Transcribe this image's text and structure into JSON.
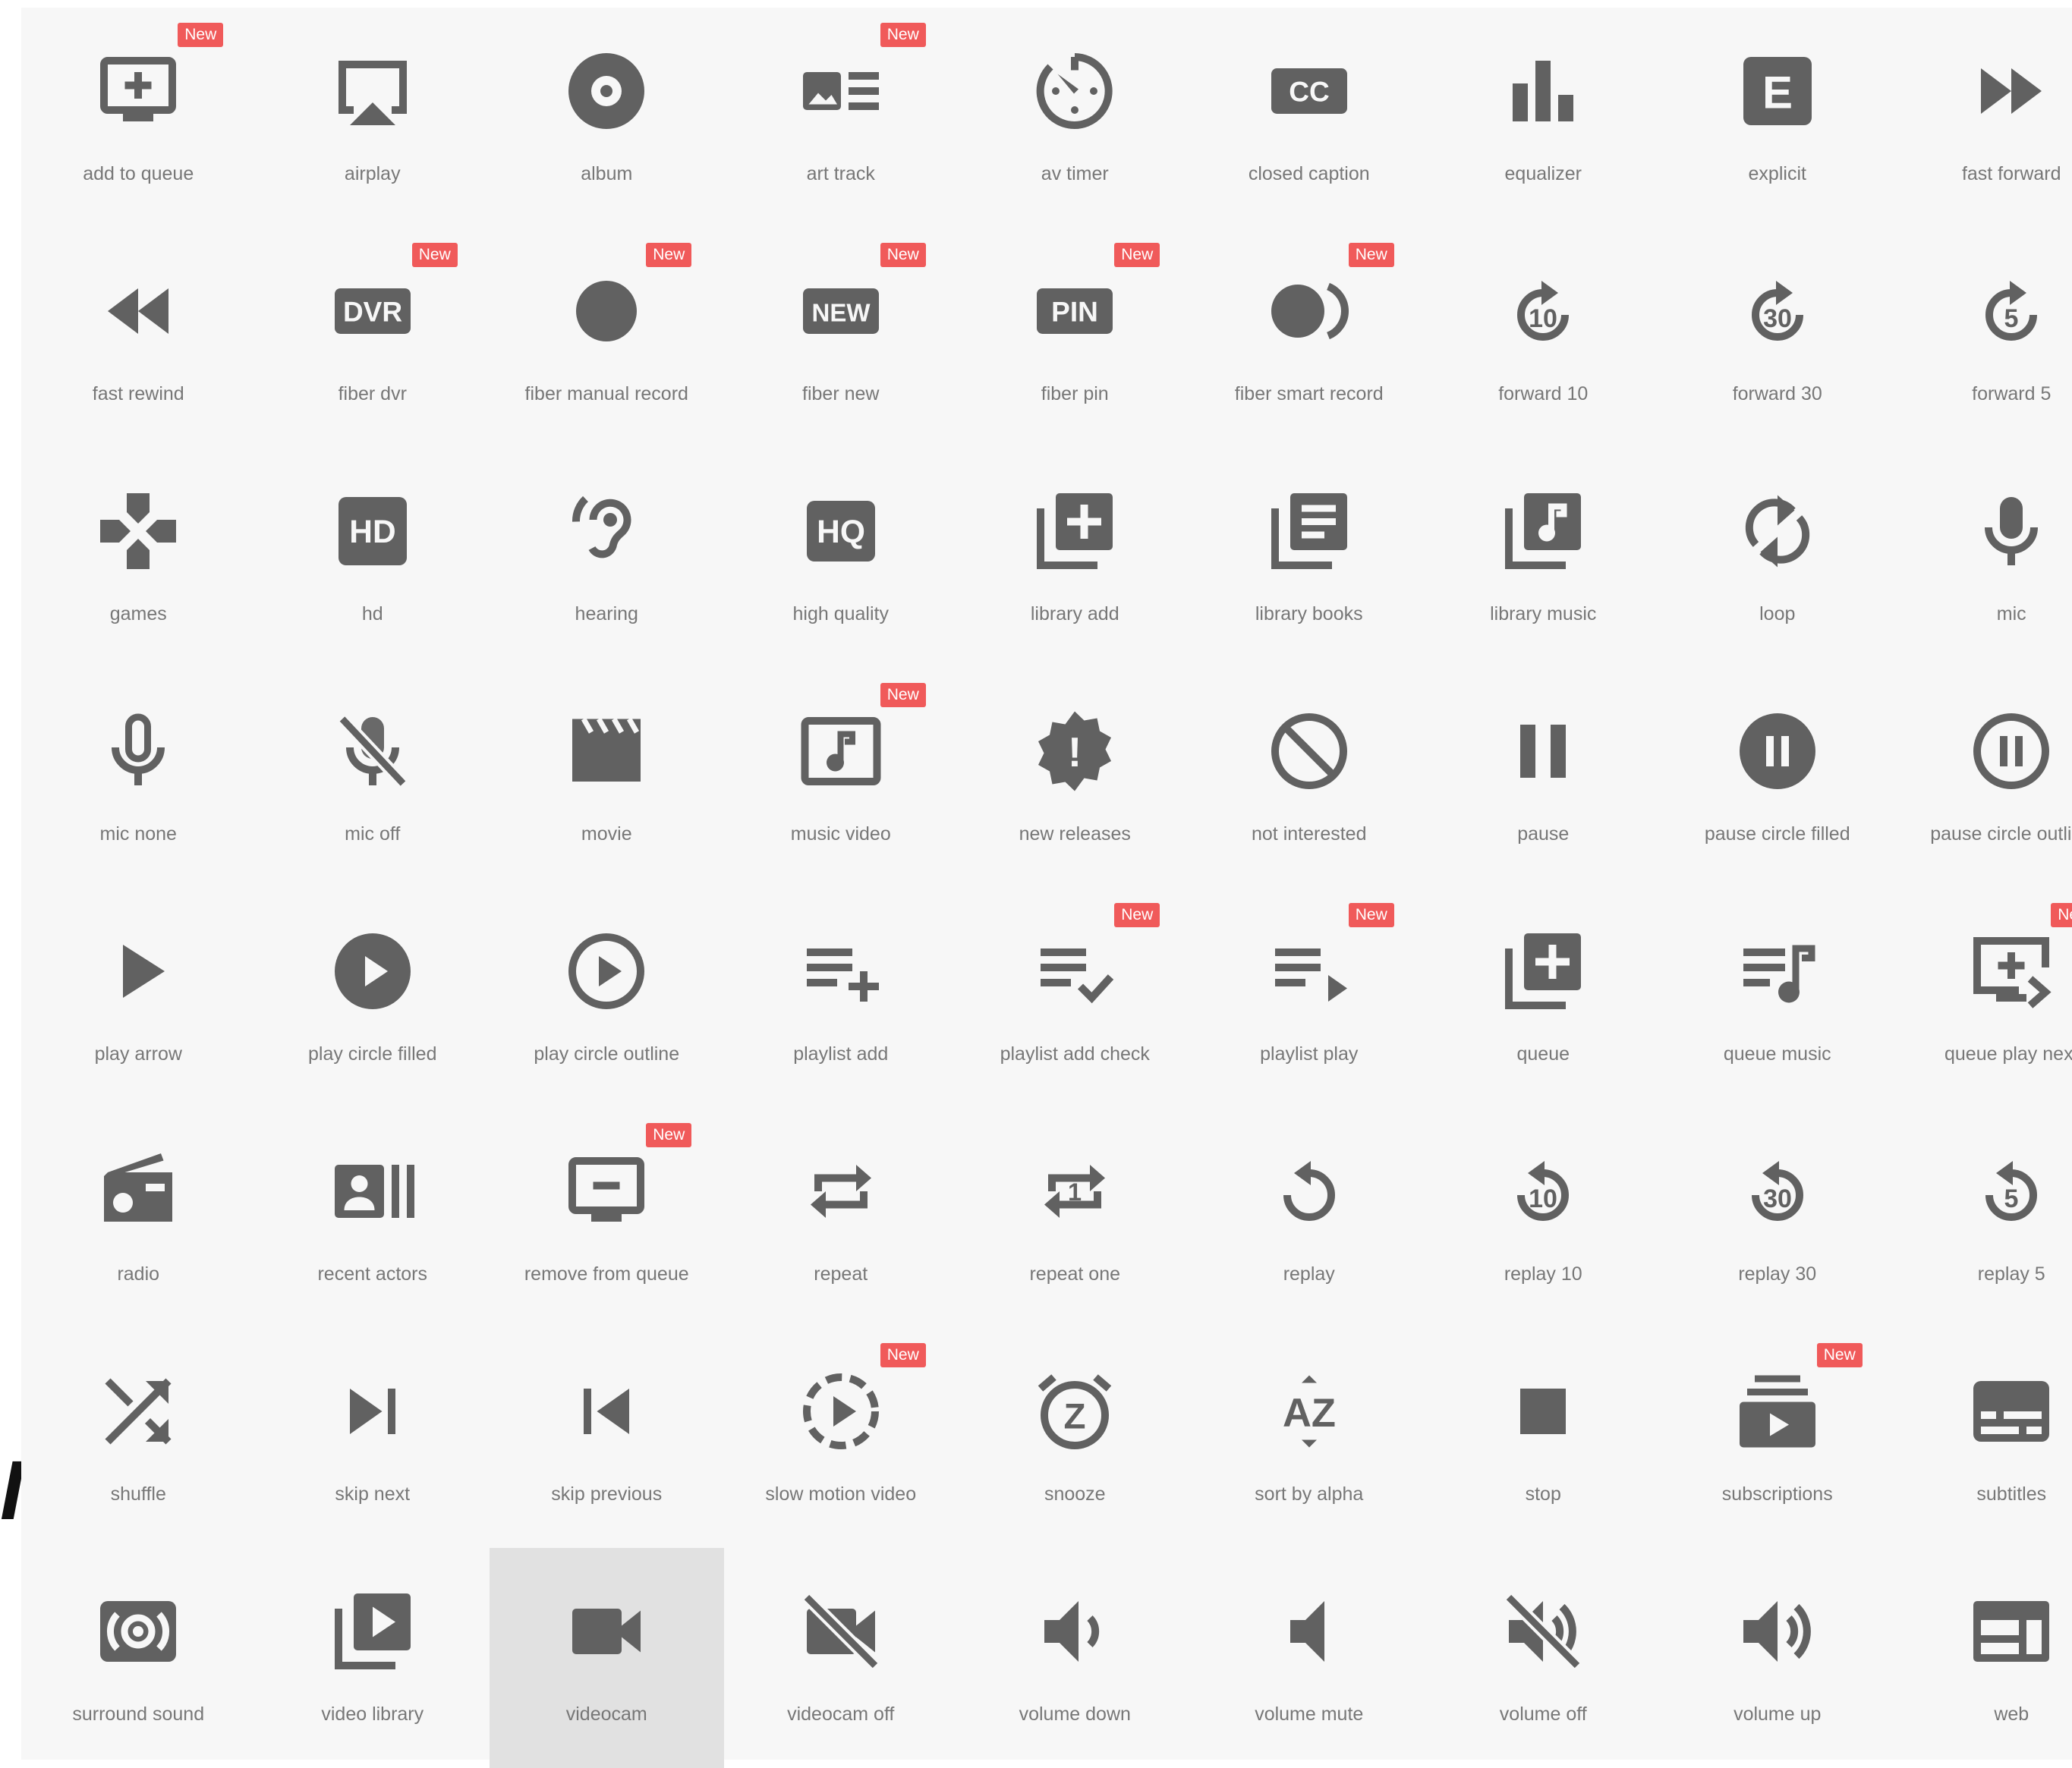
{
  "badge_label": "New",
  "edge_glyph": "I",
  "colors": {
    "icon": "#616161",
    "label": "#777777",
    "badge": "#f05a5a",
    "panel": "#f7f7f7",
    "selected": "#e1e1e1"
  },
  "icons": [
    {
      "name": "add to queue",
      "icon": "add-to-queue-icon",
      "isNew": true
    },
    {
      "name": "airplay",
      "icon": "airplay-icon"
    },
    {
      "name": "album",
      "icon": "album-icon"
    },
    {
      "name": "art track",
      "icon": "art-track-icon",
      "isNew": true
    },
    {
      "name": "av timer",
      "icon": "av-timer-icon"
    },
    {
      "name": "closed caption",
      "icon": "closed-caption-icon",
      "text": "CC"
    },
    {
      "name": "equalizer",
      "icon": "equalizer-icon"
    },
    {
      "name": "explicit",
      "icon": "explicit-icon",
      "text": "E"
    },
    {
      "name": "fast forward",
      "icon": "fast-forward-icon"
    },
    {
      "name": "fast rewind",
      "icon": "fast-rewind-icon"
    },
    {
      "name": "fiber dvr",
      "icon": "fiber-dvr-icon",
      "isNew": true,
      "text": "DVR"
    },
    {
      "name": "fiber manual record",
      "icon": "fiber-manual-record-icon",
      "isNew": true
    },
    {
      "name": "fiber new",
      "icon": "fiber-new-icon",
      "isNew": true,
      "text": "NEW"
    },
    {
      "name": "fiber pin",
      "icon": "fiber-pin-icon",
      "isNew": true,
      "text": "PIN"
    },
    {
      "name": "fiber smart record",
      "icon": "fiber-smart-record-icon",
      "isNew": true
    },
    {
      "name": "forward 10",
      "icon": "forward-10-icon",
      "text": "10"
    },
    {
      "name": "forward 30",
      "icon": "forward-30-icon",
      "text": "30"
    },
    {
      "name": "forward 5",
      "icon": "forward-5-icon",
      "text": "5"
    },
    {
      "name": "games",
      "icon": "games-icon"
    },
    {
      "name": "hd",
      "icon": "hd-icon",
      "text": "HD"
    },
    {
      "name": "hearing",
      "icon": "hearing-icon"
    },
    {
      "name": "high quality",
      "icon": "high-quality-icon",
      "text": "HQ"
    },
    {
      "name": "library add",
      "icon": "library-add-icon"
    },
    {
      "name": "library books",
      "icon": "library-books-icon"
    },
    {
      "name": "library music",
      "icon": "library-music-icon"
    },
    {
      "name": "loop",
      "icon": "loop-icon"
    },
    {
      "name": "mic",
      "icon": "mic-icon"
    },
    {
      "name": "mic none",
      "icon": "mic-none-icon"
    },
    {
      "name": "mic off",
      "icon": "mic-off-icon"
    },
    {
      "name": "movie",
      "icon": "movie-icon"
    },
    {
      "name": "music video",
      "icon": "music-video-icon",
      "isNew": true
    },
    {
      "name": "new releases",
      "icon": "new-releases-icon",
      "text": "!"
    },
    {
      "name": "not interested",
      "icon": "not-interested-icon"
    },
    {
      "name": "pause",
      "icon": "pause-icon"
    },
    {
      "name": "pause circle filled",
      "icon": "pause-circle-filled-icon"
    },
    {
      "name": "pause circle outline",
      "icon": "pause-circle-outline-icon"
    },
    {
      "name": "play arrow",
      "icon": "play-arrow-icon"
    },
    {
      "name": "play circle filled",
      "icon": "play-circle-filled-icon"
    },
    {
      "name": "play circle outline",
      "icon": "play-circle-outline-icon"
    },
    {
      "name": "playlist add",
      "icon": "playlist-add-icon"
    },
    {
      "name": "playlist add check",
      "icon": "playlist-add-check-icon",
      "isNew": true
    },
    {
      "name": "playlist play",
      "icon": "playlist-play-icon",
      "isNew": true
    },
    {
      "name": "queue",
      "icon": "queue-icon"
    },
    {
      "name": "queue music",
      "icon": "queue-music-icon"
    },
    {
      "name": "queue play next",
      "icon": "queue-play-next-icon",
      "isNew": true
    },
    {
      "name": "radio",
      "icon": "radio-icon"
    },
    {
      "name": "recent actors",
      "icon": "recent-actors-icon"
    },
    {
      "name": "remove from queue",
      "icon": "remove-from-queue-icon",
      "isNew": true
    },
    {
      "name": "repeat",
      "icon": "repeat-icon"
    },
    {
      "name": "repeat one",
      "icon": "repeat-one-icon",
      "text": "1"
    },
    {
      "name": "replay",
      "icon": "replay-icon"
    },
    {
      "name": "replay 10",
      "icon": "replay-10-icon",
      "text": "10"
    },
    {
      "name": "replay 30",
      "icon": "replay-30-icon",
      "text": "30"
    },
    {
      "name": "replay 5",
      "icon": "replay-5-icon",
      "text": "5"
    },
    {
      "name": "shuffle",
      "icon": "shuffle-icon"
    },
    {
      "name": "skip next",
      "icon": "skip-next-icon"
    },
    {
      "name": "skip previous",
      "icon": "skip-previous-icon"
    },
    {
      "name": "slow motion video",
      "icon": "slow-motion-video-icon",
      "isNew": true
    },
    {
      "name": "snooze",
      "icon": "snooze-icon",
      "text": "Z"
    },
    {
      "name": "sort by alpha",
      "icon": "sort-by-alpha-icon",
      "text": "AZ"
    },
    {
      "name": "stop",
      "icon": "stop-icon"
    },
    {
      "name": "subscriptions",
      "icon": "subscriptions-icon",
      "isNew": true
    },
    {
      "name": "subtitles",
      "icon": "subtitles-icon"
    },
    {
      "name": "surround sound",
      "icon": "surround-sound-icon"
    },
    {
      "name": "video library",
      "icon": "video-library-icon"
    },
    {
      "name": "videocam",
      "icon": "videocam-icon",
      "selected": true
    },
    {
      "name": "videocam off",
      "icon": "videocam-off-icon"
    },
    {
      "name": "volume down",
      "icon": "volume-down-icon"
    },
    {
      "name": "volume mute",
      "icon": "volume-mute-icon"
    },
    {
      "name": "volume off",
      "icon": "volume-off-icon"
    },
    {
      "name": "volume up",
      "icon": "volume-up-icon"
    },
    {
      "name": "web",
      "icon": "web-icon"
    }
  ]
}
